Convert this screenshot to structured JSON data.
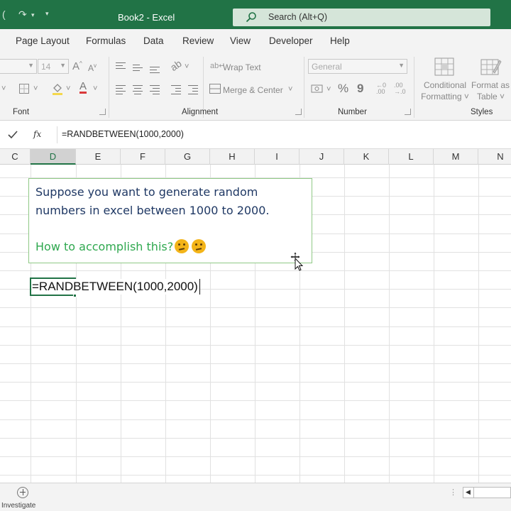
{
  "window": {
    "title": "Book2  -  Excel"
  },
  "search": {
    "placeholder": "Search (Alt+Q)"
  },
  "menu": {
    "tabs": [
      "Page Layout",
      "Formulas",
      "Data",
      "Review",
      "View",
      "Developer",
      "Help"
    ]
  },
  "ribbon": {
    "font": {
      "size": "14",
      "grow_label": "A",
      "shrink_label": "A",
      "group_label": "Font"
    },
    "alignment": {
      "wrap_text": "Wrap Text",
      "merge_center": "Merge & Center",
      "group_label": "Alignment"
    },
    "number": {
      "format": "General",
      "percent": "%",
      "comma": "9",
      "group_label": "Number"
    },
    "styles": {
      "conditional_formatting": [
        "Conditional",
        "Formatting ˅"
      ],
      "format_as_table": [
        "Format as",
        "Table ˅"
      ],
      "group_label": "Styles"
    }
  },
  "formula_bar": {
    "fx": "fx",
    "formula": "=RANDBETWEEN(1000,2000)"
  },
  "columns": [
    "C",
    "D",
    "E",
    "F",
    "G",
    "H",
    "I",
    "J",
    "K",
    "L",
    "M",
    "N"
  ],
  "active_column": "D",
  "textbox": {
    "line1": "Suppose you want to generate random",
    "line2": "numbers in excel between 1000 to 2000.",
    "question": "How to accomplish this?"
  },
  "active_cell": {
    "value": "=RANDBETWEEN(1000,2000)"
  },
  "status": {
    "text": "Investigate"
  },
  "colors": {
    "excel_green": "#217346",
    "textbox_text": "#1f3864",
    "question_text": "#2fa84f",
    "textbox_border": "#8fc985"
  },
  "icons": [
    "redo-icon",
    "customize-qat-icon",
    "search-icon",
    "enter-check-icon",
    "fx-icon",
    "move-cursor-icon",
    "add-sheet-icon"
  ]
}
